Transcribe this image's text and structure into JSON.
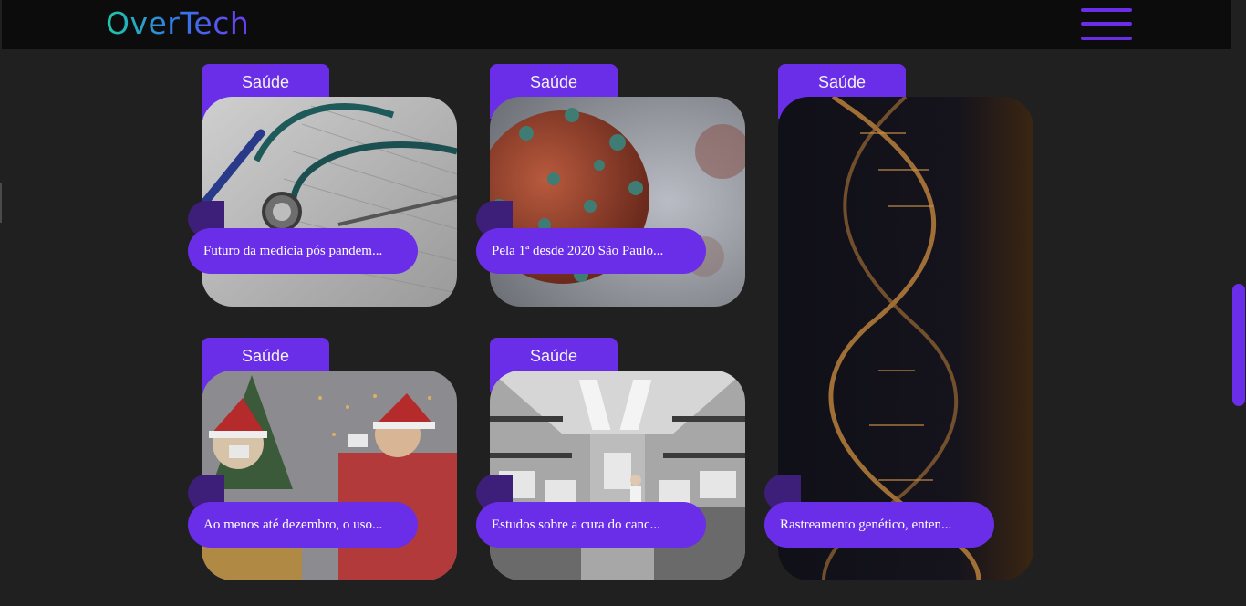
{
  "header": {
    "logo": "OverTech"
  },
  "cards": [
    {
      "tag": "Saúde",
      "title": "Futuro da medicia pós pandem...",
      "image": "stethoscope-photo"
    },
    {
      "tag": "Saúde",
      "title": "Pela 1ª desde 2020 São Paulo...",
      "image": "virus-photo"
    },
    {
      "tag": "Saúde",
      "title": "Rastreamento genético, enten...",
      "image": "dna-photo"
    },
    {
      "tag": "Saúde",
      "title": "Ao menos até dezembro, o uso...",
      "image": "christmas-people-photo"
    },
    {
      "tag": "Saúde",
      "title": "Estudos sobre a cura do canc...",
      "image": "laboratory-photo"
    }
  ],
  "colors": {
    "accent": "#6a2ee8",
    "background": "#202020",
    "header": "#0c0c0c"
  }
}
